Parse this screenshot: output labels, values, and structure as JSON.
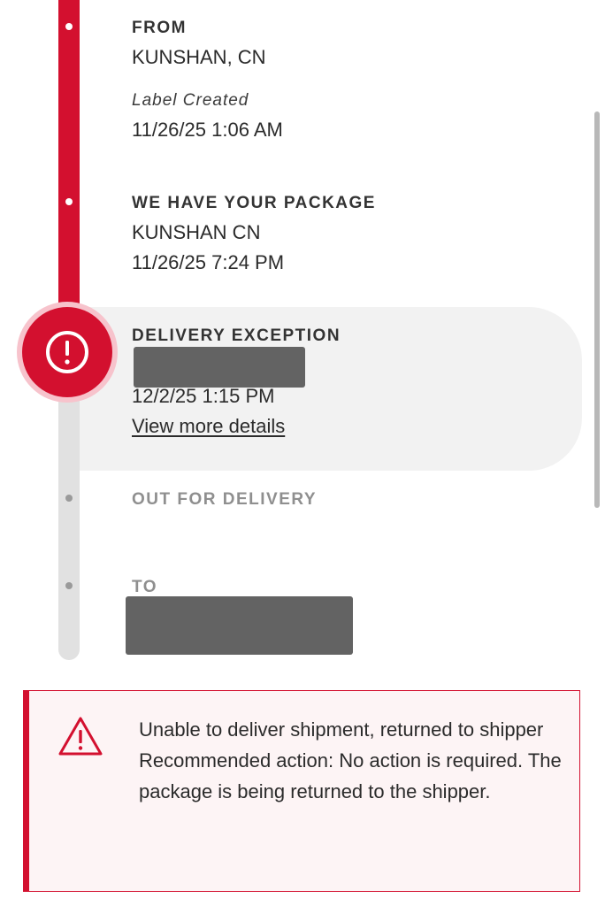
{
  "timeline": {
    "from": {
      "heading": "FROM",
      "location": "KUNSHAN, CN",
      "status": "Label Created",
      "datetime": "11/26/25 1:06 AM"
    },
    "picked_up": {
      "heading": "WE HAVE YOUR PACKAGE",
      "location": "KUNSHAN CN",
      "datetime": "11/26/25 7:24 PM"
    },
    "exception": {
      "heading": "DELIVERY EXCEPTION",
      "datetime": "12/2/25 1:15 PM",
      "link": "View more details"
    },
    "out_for_delivery": {
      "heading": "OUT FOR DELIVERY"
    },
    "to": {
      "heading": "TO"
    }
  },
  "alert": {
    "line1": "Unable to deliver shipment, returned to shipper",
    "line2": "Recommended action: No action is required. The package is being returned to the shipper."
  },
  "colors": {
    "accent": "#d3102f",
    "rail_inactive": "#e1e1e1",
    "exception_bg": "#f2f2f2",
    "alert_bg": "#fdf4f5"
  },
  "icons": {
    "exception": "exclamation-circle-icon",
    "alert": "warning-triangle-icon"
  }
}
